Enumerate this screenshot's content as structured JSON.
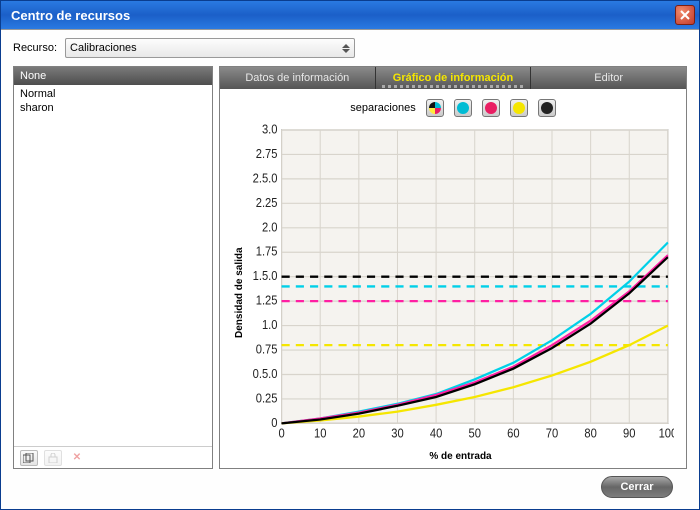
{
  "window": {
    "title": "Centro de recursos"
  },
  "resource": {
    "label": "Recurso:",
    "selected": "Calibraciones"
  },
  "list": {
    "header": "None",
    "items": [
      "Normal",
      "sharon"
    ]
  },
  "tabs": {
    "items": [
      "Datos de información",
      "Gráfico de información",
      "Editor"
    ],
    "activeIndex": 1
  },
  "separations": {
    "label": "separaciones"
  },
  "chart": {
    "ylabel": "Densidad de salida",
    "xlabel": "% de entrada"
  },
  "footer": {
    "close": "Cerrar"
  },
  "chart_data": {
    "type": "line",
    "xlabel": "% de entrada",
    "ylabel": "Densidad de salida",
    "xlim": [
      0,
      100
    ],
    "ylim": [
      0,
      3.0
    ],
    "xticks": [
      0,
      10,
      20,
      30,
      40,
      50,
      60,
      70,
      80,
      90,
      100
    ],
    "yticks": [
      0,
      0.25,
      0.5,
      0.75,
      1.0,
      1.25,
      1.5,
      1.75,
      2.0,
      2.25,
      2.5,
      2.75,
      3.0
    ],
    "series": [
      {
        "name": "C target",
        "color": "#00d0e8",
        "dashed": true,
        "values": [
          1.4,
          1.4,
          1.4,
          1.4,
          1.4,
          1.4,
          1.4,
          1.4,
          1.4,
          1.4,
          1.4
        ]
      },
      {
        "name": "M target",
        "color": "#ff1fa3",
        "dashed": true,
        "values": [
          1.25,
          1.25,
          1.25,
          1.25,
          1.25,
          1.25,
          1.25,
          1.25,
          1.25,
          1.25,
          1.25
        ]
      },
      {
        "name": "Y target",
        "color": "#f5e600",
        "dashed": true,
        "values": [
          0.8,
          0.8,
          0.8,
          0.8,
          0.8,
          0.8,
          0.8,
          0.8,
          0.8,
          0.8,
          0.8
        ]
      },
      {
        "name": "K target",
        "color": "#000000",
        "dashed": true,
        "values": [
          1.5,
          1.5,
          1.5,
          1.5,
          1.5,
          1.5,
          1.5,
          1.5,
          1.5,
          1.5,
          1.5
        ]
      },
      {
        "name": "C",
        "color": "#00d0e8",
        "dashed": false,
        "values": [
          0.0,
          0.05,
          0.12,
          0.2,
          0.3,
          0.45,
          0.62,
          0.85,
          1.12,
          1.45,
          1.85
        ]
      },
      {
        "name": "M",
        "color": "#ff1fa3",
        "dashed": false,
        "values": [
          0.0,
          0.05,
          0.11,
          0.19,
          0.29,
          0.42,
          0.58,
          0.8,
          1.05,
          1.35,
          1.72
        ]
      },
      {
        "name": "Y",
        "color": "#f5e600",
        "dashed": false,
        "values": [
          0.0,
          0.03,
          0.07,
          0.12,
          0.19,
          0.27,
          0.37,
          0.49,
          0.63,
          0.8,
          1.0
        ]
      },
      {
        "name": "K",
        "color": "#000000",
        "dashed": false,
        "values": [
          0.0,
          0.04,
          0.1,
          0.18,
          0.27,
          0.4,
          0.56,
          0.77,
          1.02,
          1.33,
          1.7
        ]
      }
    ],
    "x": [
      0,
      10,
      20,
      30,
      40,
      50,
      60,
      70,
      80,
      90,
      100
    ]
  }
}
